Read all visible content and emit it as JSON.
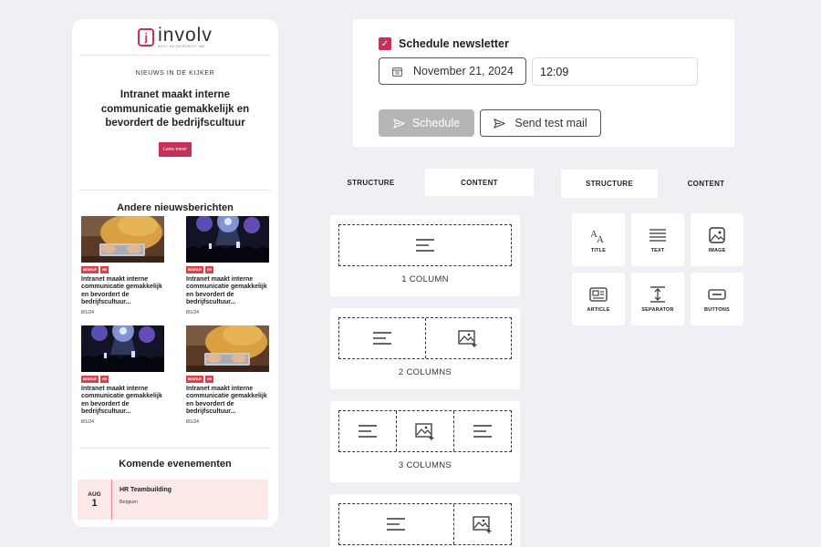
{
  "preview": {
    "logo": {
      "name": "involv",
      "mark": "j",
      "subtitle": "BUILT ON MICROSOFT 365"
    },
    "featured": {
      "kicker": "NIEUWS IN DE KIJKER",
      "title": "Intranet maakt interne communicatie gemakkelijk en bevordert de bedrijfscultuur",
      "button": "Lees meer"
    },
    "other_news_title": "Andere nieuwsberichten",
    "news": [
      {
        "image": "laptop",
        "tags": [
          "BEDRIJF",
          "HR"
        ],
        "title": "Intranet maakt interne communicatie gemakkelijk en bevordert de bedrijfscultuur...",
        "date": "8/1/24"
      },
      {
        "image": "concert",
        "tags": [
          "BEDRIJF",
          "HR"
        ],
        "title": "Intranet maakt interne communicatie gemakkelijk en bevordert de bedrijfscultuur...",
        "date": "8/1/24"
      },
      {
        "image": "concert",
        "tags": [
          "BEDRIJF",
          "HR"
        ],
        "title": "Intranet maakt interne communicatie gemakkelijk en bevordert de bedrijfscultuur...",
        "date": "8/1/24"
      },
      {
        "image": "laptop",
        "tags": [
          "BEDRIJF",
          "HR"
        ],
        "title": "Intranet maakt interne communicatie gemakkelijk en bevordert de bedrijfscultuur...",
        "date": "8/1/24"
      }
    ],
    "events_title": "Komende evenementen",
    "event": {
      "month": "AUG",
      "day": "1",
      "name": "HR Teambuilding",
      "location": "Belgium"
    }
  },
  "schedule": {
    "checkbox_label": "Schedule newsletter",
    "checked": true,
    "date": "November 21, 2024",
    "time": "12:09",
    "schedule_button": "Schedule",
    "test_button": "Send test mail"
  },
  "layout_tabs": {
    "structure": "STRUCTURE",
    "content": "CONTENT"
  },
  "layouts": [
    {
      "label": "1 COLUMN"
    },
    {
      "label": "2 COLUMNS"
    },
    {
      "label": "3 COLUMNS"
    },
    {
      "label": ""
    }
  ],
  "block_tabs": {
    "structure": "STRUCTURE",
    "content": "CONTENT"
  },
  "blocks": [
    {
      "label": "TITLE",
      "icon": "title-icon"
    },
    {
      "label": "TEXT",
      "icon": "text-icon"
    },
    {
      "label": "IMAGE",
      "icon": "image-icon"
    },
    {
      "label": "ARTICLE",
      "icon": "article-icon"
    },
    {
      "label": "SEPARATOR",
      "icon": "separator-icon"
    },
    {
      "label": "BUTTONS",
      "icon": "buttons-icon"
    }
  ],
  "colors": {
    "accent": "#c8305a",
    "tag": "#d9424b",
    "event_bg": "#fde8e8",
    "disabled": "#b5b5b5",
    "background": "#eef0f3"
  }
}
